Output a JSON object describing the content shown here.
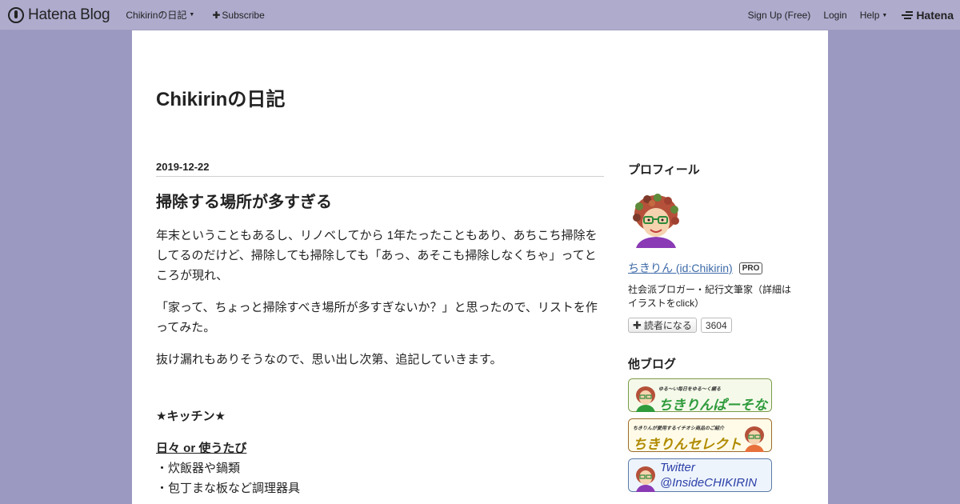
{
  "globalbar": {
    "brand": "Hatena Blog",
    "blog_menu": "Chikirinの日記",
    "subscribe": "Subscribe",
    "signup": "Sign Up (Free)",
    "login": "Login",
    "help": "Help",
    "hatena": "Hatena"
  },
  "blog": {
    "title": "Chikirinの日記"
  },
  "entry": {
    "date": "2019-12-22",
    "title": "掃除する場所が多すぎる",
    "paragraphs": [
      "年末ということもあるし、リノベしてから 1年たったこともあり、あちこち掃除をしてるのだけど、掃除しても掃除しても「あっ、あそこも掃除しなくちゃ」ってところが現れ、",
      "「家って、ちょっと掃除すべき場所が多すぎないか？」と思ったので、リストを作ってみた。",
      "抜け漏れもありそうなので、思い出し次第、追記していきます。"
    ],
    "section": "★キッチン★",
    "subheading": "日々 or 使うたび",
    "items": [
      "・炊飯器や鍋類",
      "・包丁まな板など調理器具"
    ]
  },
  "sidebar": {
    "profile_title": "プロフィール",
    "profile_name": "ちきりん (id:Chikirin)",
    "pro_badge": "PRO",
    "profile_desc": "社会派ブロガー・紀行文筆家（詳細はイラストをclick）",
    "subscribe_label": "読者になる",
    "reader_count": "3604",
    "other_blogs_title": "他ブログ",
    "banners": [
      {
        "caption": "ゆる〜い毎日をゆる〜く綴る",
        "name": "ちきりんぱーそなる",
        "color": "#2f9b3c",
        "border": "#7a9b4a"
      },
      {
        "caption": "ちきりんが愛用するイチオシ商品のご紹介",
        "name": "ちきりんセレクト",
        "color": "#b08a00",
        "border": "#9b6a2a"
      },
      {
        "caption": "Twitter",
        "name": "@InsideCHIKIRIN",
        "color": "#2b3fa8",
        "border": "#5a7aa8"
      }
    ]
  },
  "colors": {
    "page_bg": "#9b98c2",
    "globalbar_bg": "#aeabcd",
    "link": "#3d6aa8"
  }
}
